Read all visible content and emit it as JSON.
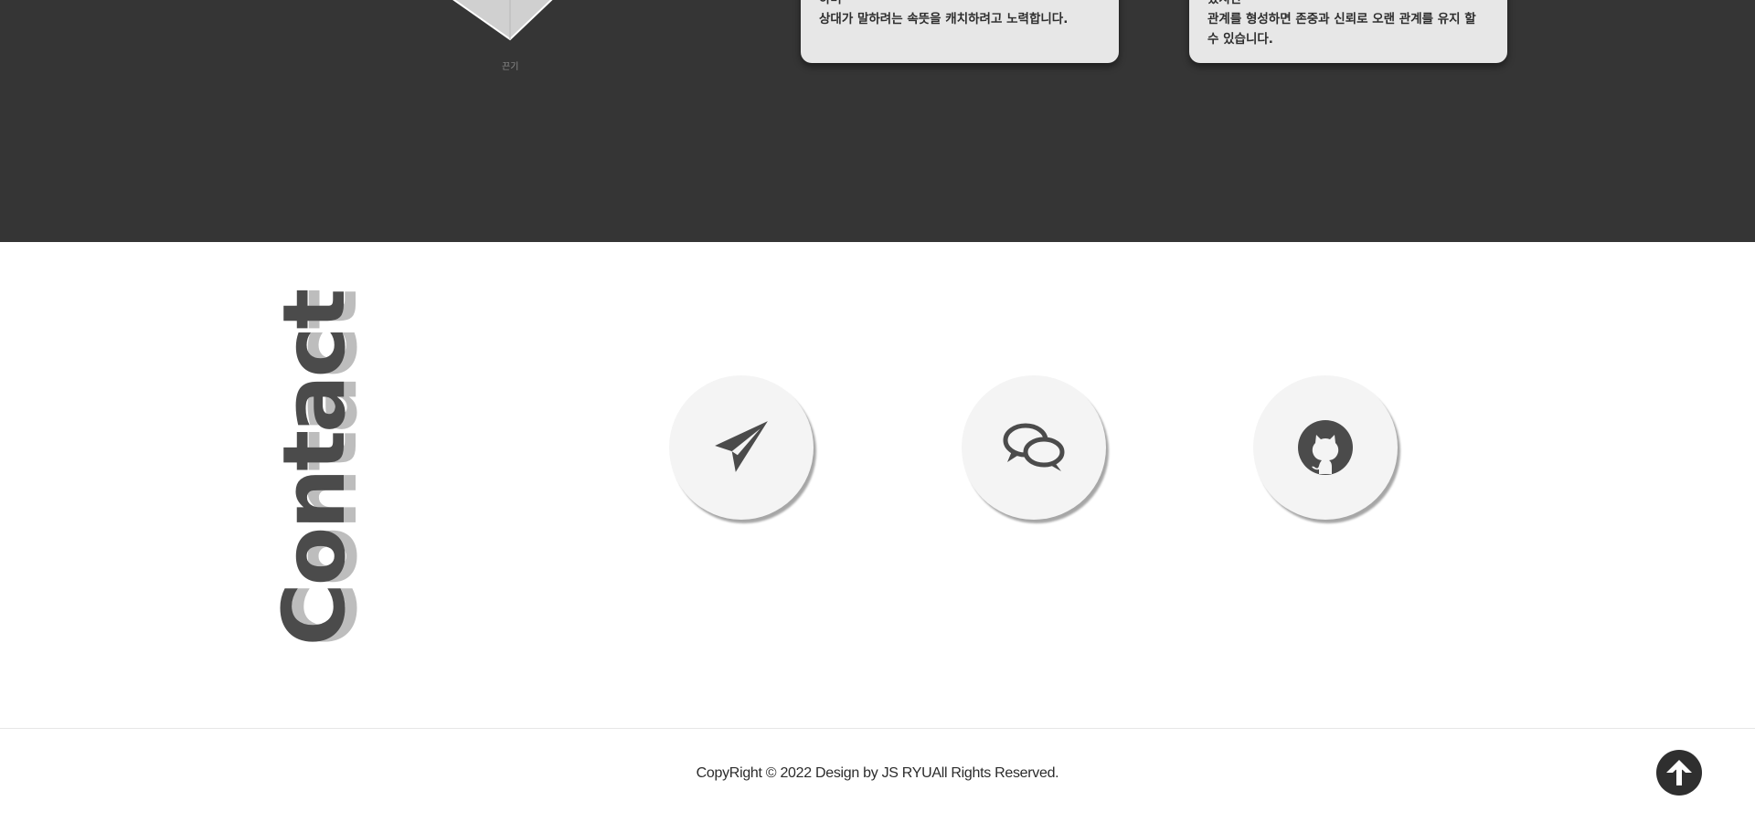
{
  "skills_section": {
    "radar_axis_label": "끈기",
    "cards": [
      {
        "lines": [
          "하며",
          "상대가 말하려는 속뜻을 캐치하려고 노력합니다."
        ]
      },
      {
        "lines": [
          "있지만",
          "관계를 형성하면 존중과 신뢰로 오랜 관계를 유지 할",
          "수 있습니다."
        ]
      }
    ]
  },
  "contact": {
    "title": "Contact",
    "buttons": [
      {
        "icon": "paper-plane-icon"
      },
      {
        "icon": "chat-bubbles-icon"
      },
      {
        "icon": "github-icon"
      }
    ]
  },
  "footer": {
    "copyright": "CopyRight © 2022 Design by JS RYUAll Rights Reserved.",
    "to_top_icon": "arrow-up-icon"
  },
  "colors": {
    "dark_bg": "#353535",
    "card_bg": "#e7e7e7",
    "icon": "#4b4b4b",
    "button_bg": "#f4f4f4"
  }
}
